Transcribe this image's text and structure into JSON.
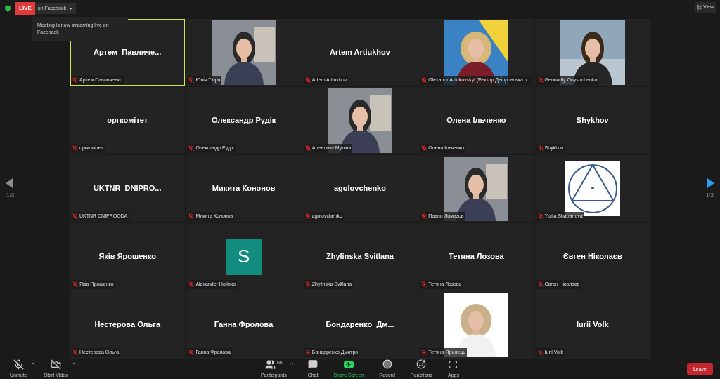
{
  "top_bar": {
    "live_badge": "LIVE",
    "stream_target": "on Facebook",
    "tooltip": "Meeting is now streaming live on Facebook",
    "view_button": "View"
  },
  "pager": {
    "left": "1/3",
    "right": "1/3"
  },
  "tiles": [
    {
      "kind": "name",
      "display": "Артем  Павличе...",
      "label": "Артем Павличенко",
      "muted": true,
      "active_speaker": true
    },
    {
      "label": "Юлія Тюря",
      "muted": true,
      "active_speaker": false
    },
    {
      "kind": "name",
      "display": "Artem Artiukhov",
      "label": "Artem Artiukhov",
      "muted": true,
      "active_speaker": false
    },
    {
      "label": "Olexandr Aziukovskyi (Ректор Дніпровська п...",
      "muted": true,
      "active_speaker": false
    },
    {
      "label": "Gennadiy Onyshchenko",
      "muted": true,
      "active_speaker": false
    },
    {
      "kind": "name",
      "display": "оргкомітет",
      "label": "оргкомітет",
      "muted": true,
      "active_speaker": false
    },
    {
      "kind": "name",
      "display": "Олександр Рудік",
      "label": "Олександр Рудік",
      "muted": true,
      "active_speaker": false
    },
    {
      "label": "Алевтина Муліна",
      "muted": true,
      "active_speaker": false
    },
    {
      "kind": "name",
      "display": "Олена Ільченко",
      "label": "Олена Ільченко",
      "muted": true,
      "active_speaker": false
    },
    {
      "kind": "name",
      "display": "Shykhov",
      "label": "Shykhov",
      "muted": true,
      "active_speaker": false
    },
    {
      "kind": "name",
      "display": "UKTNR  DNIPRO...",
      "label": "UKTNR DNIPROODA",
      "muted": true,
      "active_speaker": false
    },
    {
      "kind": "name",
      "display": "Микита Кононов",
      "label": "Микита Кононов",
      "muted": true,
      "active_speaker": false
    },
    {
      "kind": "name",
      "display": "agolovchenko",
      "label": "agolovchenko",
      "muted": true,
      "active_speaker": false
    },
    {
      "label": "Павло Ломазов",
      "muted": true,
      "active_speaker": false
    },
    {
      "kind": "logo",
      "label": "Yuliia Shabanova",
      "muted": true,
      "active_speaker": false
    },
    {
      "kind": "name",
      "display": "Яків Ярошенко",
      "label": "Яків Ярошенко",
      "muted": true,
      "active_speaker": false
    },
    {
      "kind": "avatar",
      "display": "S",
      "label": "Alexander Holinko",
      "muted": true,
      "active_speaker": false
    },
    {
      "kind": "name",
      "display": "Zhylinska Svitlana",
      "label": "Zhylinska Svitlana",
      "muted": true,
      "active_speaker": false
    },
    {
      "kind": "name",
      "display": "Тетяна Лозова",
      "label": "Тетяна Лозова",
      "muted": true,
      "active_speaker": false
    },
    {
      "kind": "name",
      "display": "Євген Ніколаєв",
      "label": "Євген Ніколаєв",
      "muted": true,
      "active_speaker": false
    },
    {
      "kind": "name",
      "display": "Нестерова Ольга",
      "label": "Нестерова Ольга",
      "muted": true,
      "active_speaker": false
    },
    {
      "kind": "name",
      "display": "Ганна Фролова",
      "label": "Ганна Фролова",
      "muted": true,
      "active_speaker": false
    },
    {
      "kind": "name",
      "display": "Бондаренко  Дм...",
      "label": "Бондаренко Дмитро",
      "muted": true,
      "active_speaker": false
    },
    {
      "label": "Тетяна Ярилець",
      "muted": true,
      "active_speaker": false
    },
    {
      "kind": "name",
      "display": "Iurii Volk",
      "label": "Iurii Volk",
      "muted": true,
      "active_speaker": false
    }
  ],
  "toolbar": {
    "items": [
      {
        "kind": "mic",
        "label": "Unmute",
        "caret": true
      },
      {
        "kind": "video",
        "label": "Start Video",
        "caret": true
      },
      {
        "kind": "participants",
        "label": "Participants",
        "count": "68",
        "caret": true
      },
      {
        "kind": "chat",
        "label": "Chat",
        "caret": false
      },
      {
        "kind": "share",
        "label": "Share Screen",
        "caret": false
      },
      {
        "kind": "record",
        "label": "Record",
        "caret": false
      },
      {
        "kind": "reactions",
        "label": "Reactions",
        "caret": false
      },
      {
        "kind": "apps",
        "label": "Apps",
        "caret": false
      }
    ],
    "leave": "Leave"
  }
}
